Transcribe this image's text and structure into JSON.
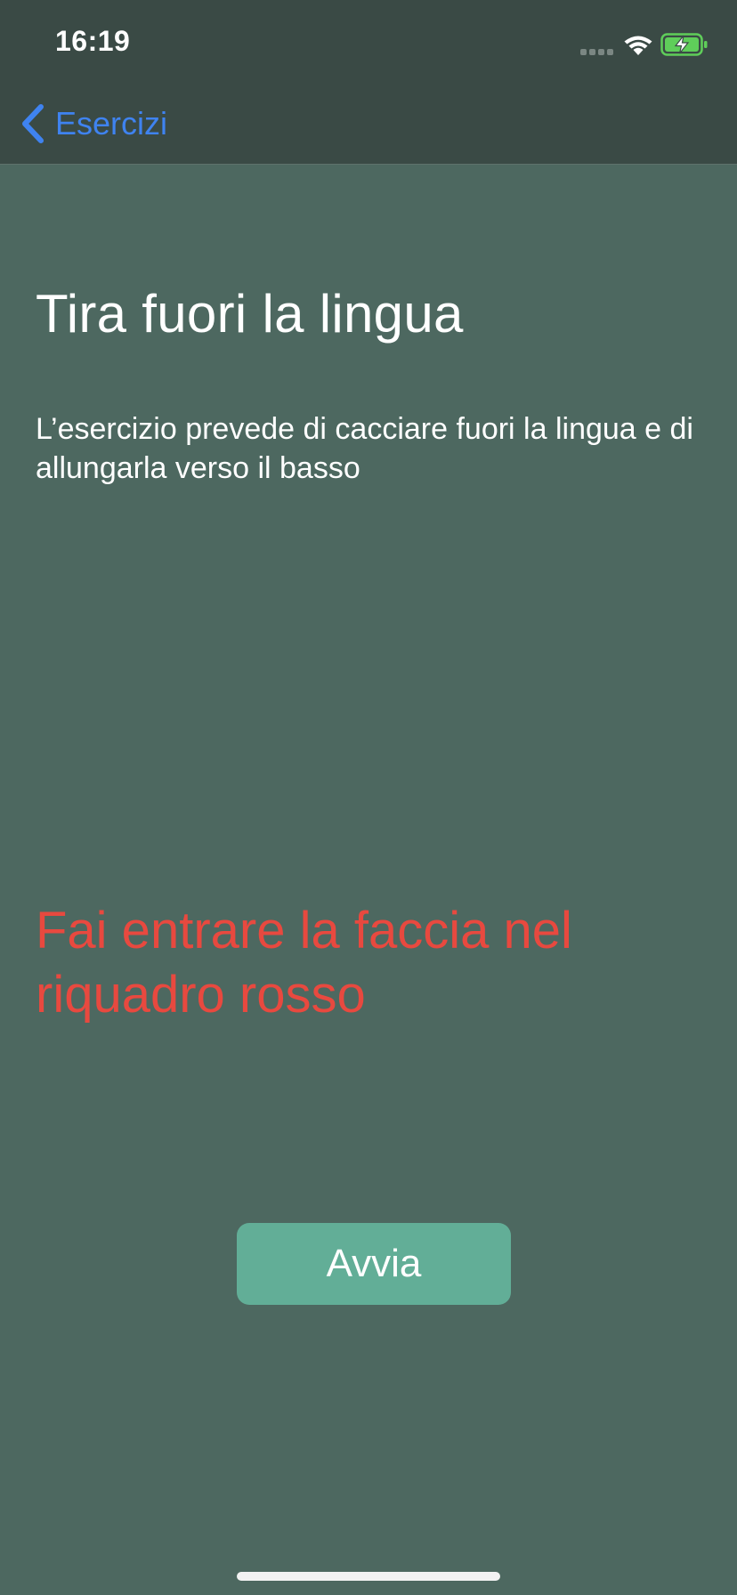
{
  "status_bar": {
    "time": "16:19",
    "signal_icon": "cellular-signal-icon",
    "wifi_icon": "wifi-icon",
    "battery_icon": "battery-charging-icon"
  },
  "nav": {
    "back_label": "Esercizi",
    "back_icon": "chevron-left-icon"
  },
  "exercise": {
    "title": "Tira fuori la lingua",
    "description": "L’esercizio prevede di cacciare fuori la lingua e di allungarla verso il basso",
    "warning": "Fai entrare la faccia nel riquadro rosso",
    "start_label": "Avvia"
  },
  "colors": {
    "background": "#4d6860",
    "bar": "#3a4a45",
    "link": "#3f83f0",
    "warning": "#e8493f",
    "button": "#62ae97",
    "battery": "#5fce5a"
  }
}
